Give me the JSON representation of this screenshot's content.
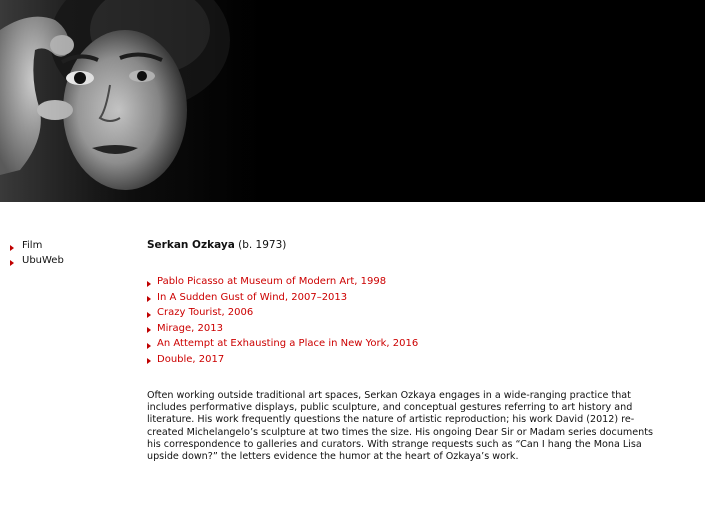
{
  "banner": {
    "image_alt": "portrait-photo"
  },
  "nav": {
    "items": [
      {
        "label": "Film"
      },
      {
        "label": "UbuWeb"
      }
    ]
  },
  "artist": {
    "name": "Serkan Ozkaya",
    "dates": "(b. 1973)"
  },
  "works": [
    {
      "label": "Pablo Picasso at Museum of Modern Art, 1998"
    },
    {
      "label": "In A Sudden Gust of Wind, 2007–2013"
    },
    {
      "label": "Crazy Tourist, 2006"
    },
    {
      "label": "Mirage, 2013"
    },
    {
      "label": "An Attempt at Exhausting a Place in New York, 2016"
    },
    {
      "label": "Double, 2017"
    }
  ],
  "bio": {
    "text": "Often working outside traditional art spaces, Serkan Ozkaya engages in a wide-ranging practice that includes performative displays, public sculpture, and conceptual gestures referring to art history and literature. His work frequently questions the nature of artistic reproduction; his work David (2012) re-created Michelangelo’s sculpture at two times the size. His ongoing Dear Sir or Madam series documents his correspondence to galleries and curators. With strange requests such as “Can I hang the Mona Lisa upside down?” the letters evidence the humor at the heart of Ozkaya’s work."
  },
  "colors": {
    "link": "#cc0000",
    "arrow": "#c00000",
    "banner_bg": "#000000",
    "text": "#111111"
  }
}
